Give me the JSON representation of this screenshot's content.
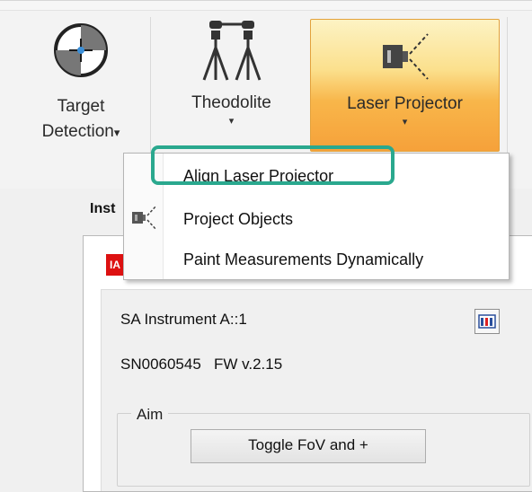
{
  "ribbon": {
    "target_detection": {
      "line1": "Target",
      "line2": "Detection",
      "arrow": "▾"
    },
    "theodolite": {
      "label": "Theodolite",
      "arrow": "▾"
    },
    "laser_projector": {
      "label": "Laser Projector",
      "arrow": "▾"
    }
  },
  "menu": {
    "items": [
      {
        "label": "Align Laser Projector"
      },
      {
        "label": "Project Objects"
      },
      {
        "label": "Paint Measurements Dynamically"
      }
    ]
  },
  "panel": {
    "tab_label": "Inst",
    "logo_text": "IA",
    "instrument_name": "SA Instrument A::1",
    "serial_firmware": "SN0060545   FW v.2.15",
    "aim_group_label": "Aim",
    "toggle_button": "Toggle FoV and +"
  },
  "colors": {
    "highlight": "#2aa88e",
    "laser_button_top": "#fdf3c4",
    "laser_button_bottom": "#f6a13a"
  },
  "icons": {
    "target_detection": "target-crosshair-icon",
    "theodolite": "theodolite-icon",
    "laser_projector": "laser-projector-icon"
  }
}
